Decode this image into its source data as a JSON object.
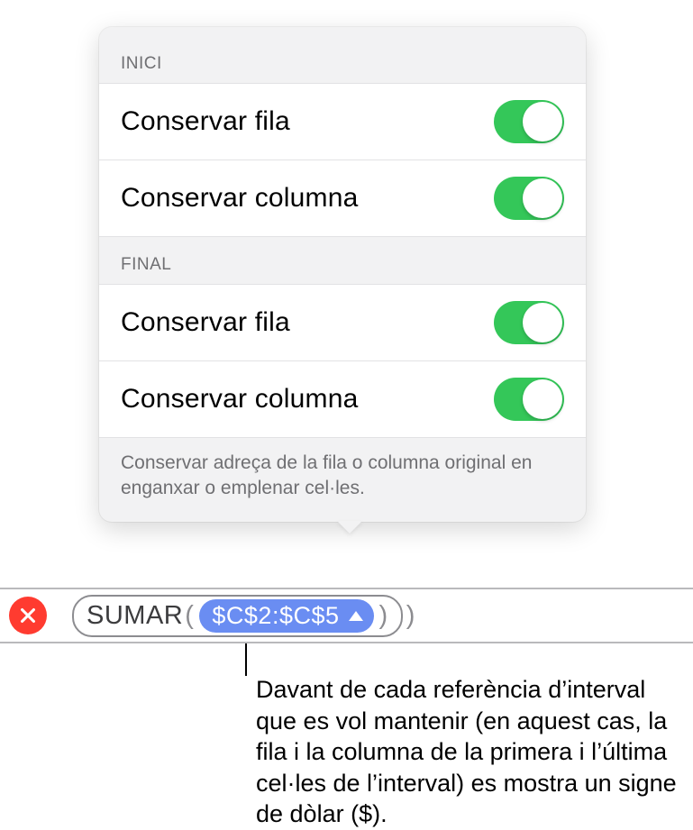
{
  "popover": {
    "sections": [
      {
        "header": "INICI",
        "rows": [
          {
            "label": "Conservar fila",
            "on": true
          },
          {
            "label": "Conservar columna",
            "on": true
          }
        ]
      },
      {
        "header": "FINAL",
        "rows": [
          {
            "label": "Conservar fila",
            "on": true
          },
          {
            "label": "Conservar columna",
            "on": true
          }
        ]
      }
    ],
    "hint": "Conservar adreça de la fila o columna original en enganxar o emplenar cel·les."
  },
  "formula": {
    "function_name": "SUMAR",
    "open_paren": "(",
    "reference": "$C$2:$C$5",
    "close_paren": ")",
    "trailing_paren": ")"
  },
  "callout_text": "Davant de cada referència d’interval que es vol mantenir (en aquest cas, la fila i la columna de la primera i l’última cel·les de l’interval) es mostra un signe de dòlar ($)."
}
